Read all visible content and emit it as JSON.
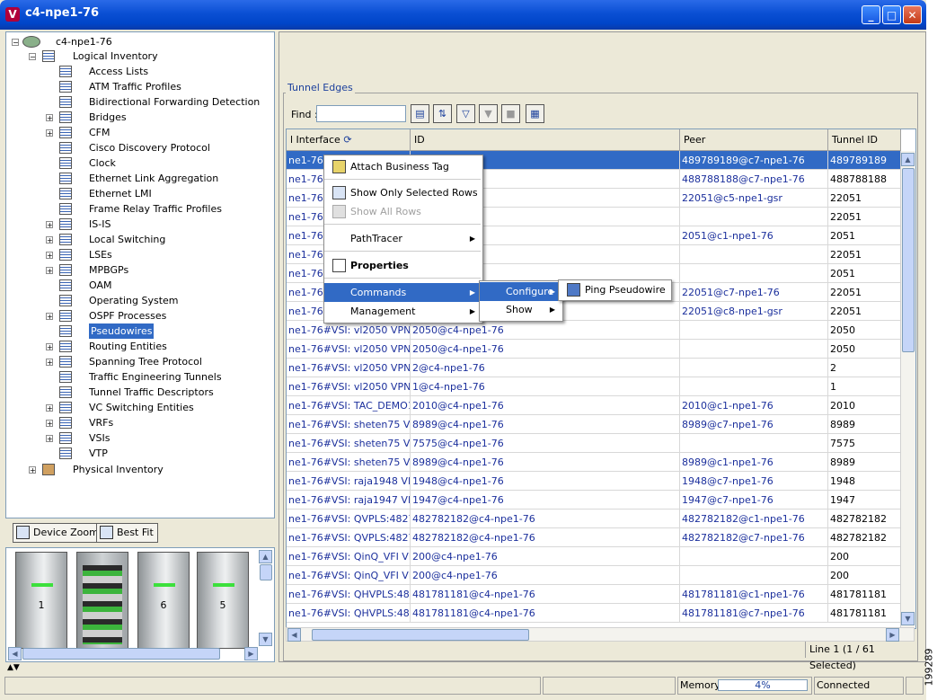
{
  "window": {
    "title": "c4-npe1-76",
    "app_icon": "V"
  },
  "tree": {
    "root": "c4-npe1-76",
    "logical": "Logical Inventory",
    "items": [
      {
        "label": "Access Lists",
        "exp": false
      },
      {
        "label": "ATM Traffic Profiles",
        "exp": false
      },
      {
        "label": "Bidirectional Forwarding Detection",
        "exp": false
      },
      {
        "label": "Bridges",
        "exp": true
      },
      {
        "label": "CFM",
        "exp": true
      },
      {
        "label": "Cisco Discovery Protocol",
        "exp": false
      },
      {
        "label": "Clock",
        "exp": false
      },
      {
        "label": "Ethernet Link Aggregation",
        "exp": false
      },
      {
        "label": "Ethernet LMI",
        "exp": false
      },
      {
        "label": "Frame Relay Traffic Profiles",
        "exp": false
      },
      {
        "label": "IS-IS",
        "exp": true
      },
      {
        "label": "Local Switching",
        "exp": true
      },
      {
        "label": "LSEs",
        "exp": true
      },
      {
        "label": "MPBGPs",
        "exp": true
      },
      {
        "label": "OAM",
        "exp": false
      },
      {
        "label": "Operating System",
        "exp": false
      },
      {
        "label": "OSPF Processes",
        "exp": true
      },
      {
        "label": "Pseudowires",
        "exp": false
      },
      {
        "label": "Routing Entities",
        "exp": true
      },
      {
        "label": "Spanning Tree Protocol",
        "exp": true
      },
      {
        "label": "Traffic Engineering Tunnels",
        "exp": false
      },
      {
        "label": "Tunnel Traffic Descriptors",
        "exp": false
      },
      {
        "label": "VC Switching Entities",
        "exp": true
      },
      {
        "label": "VRFs",
        "exp": true
      },
      {
        "label": "VSIs",
        "exp": true
      },
      {
        "label": "VTP",
        "exp": false
      }
    ],
    "selected": "Pseudowires",
    "physical": "Physical Inventory"
  },
  "zoom": {
    "device_zoom": "Device Zoom",
    "best_fit": "Best Fit"
  },
  "chassis": {
    "slots": [
      "1",
      "",
      "6",
      "5"
    ]
  },
  "tunnel": {
    "legend": "Tunnel Edges",
    "find_label": "Find :",
    "headers": [
      "l Interface",
      "ID",
      "Peer",
      "Tunnel ID"
    ],
    "rows": [
      [
        "ne1-76#V",
        "",
        "489789189@c7-npe1-76",
        "489789189"
      ],
      [
        "ne1-76#V",
        "",
        "488788188@c7-npe1-76",
        "488788188"
      ],
      [
        "ne1-76#V",
        "",
        "22051@c5-npe1-gsr",
        "22051"
      ],
      [
        "ne1-76#V",
        "",
        "",
        "22051"
      ],
      [
        "ne1-76#V",
        "",
        "2051@c1-npe1-76",
        "2051"
      ],
      [
        "ne1-76#V",
        "",
        "",
        "22051"
      ],
      [
        "ne1-76#V",
        "",
        "",
        "2051"
      ],
      [
        "ne1-76#V",
        "",
        "22051@c7-npe1-76",
        "22051"
      ],
      [
        "ne1-76#V",
        "",
        "22051@c8-npe1-gsr",
        "22051"
      ],
      [
        "ne1-76#VSI: vl2050 VPN I...",
        "2050@c4-npe1-76",
        "",
        "2050"
      ],
      [
        "ne1-76#VSI: vl2050 VPN I...",
        "2050@c4-npe1-76",
        "",
        "2050"
      ],
      [
        "ne1-76#VSI: vl2050 VPN I...",
        "2@c4-npe1-76",
        "",
        "2"
      ],
      [
        "ne1-76#VSI: vl2050 VPN I...",
        "1@c4-npe1-76",
        "",
        "1"
      ],
      [
        "ne1-76#VSI: TAC_DEMO1 ...",
        "2010@c4-npe1-76",
        "2010@c1-npe1-76",
        "2010"
      ],
      [
        "ne1-76#VSI: sheten75 VP...",
        "8989@c4-npe1-76",
        "8989@c7-npe1-76",
        "8989"
      ],
      [
        "ne1-76#VSI: sheten75 VP...",
        "7575@c4-npe1-76",
        "",
        "7575"
      ],
      [
        "ne1-76#VSI: sheten75 VP...",
        "8989@c4-npe1-76",
        "8989@c1-npe1-76",
        "8989"
      ],
      [
        "ne1-76#VSI: raja1948 VPN...",
        "1948@c4-npe1-76",
        "1948@c7-npe1-76",
        "1948"
      ],
      [
        "ne1-76#VSI: raja1947 VPN...",
        "1947@c4-npe1-76",
        "1947@c7-npe1-76",
        "1947"
      ],
      [
        "ne1-76#VSI: QVPLS:4827...",
        "482782182@c4-npe1-76",
        "482782182@c1-npe1-76",
        "482782182"
      ],
      [
        "ne1-76#VSI: QVPLS:4827...",
        "482782182@c4-npe1-76",
        "482782182@c7-npe1-76",
        "482782182"
      ],
      [
        "ne1-76#VSI: QinQ_VFI VP...",
        "200@c4-npe1-76",
        "",
        "200"
      ],
      [
        "ne1-76#VSI: QinQ_VFI VP...",
        "200@c4-npe1-76",
        "",
        "200"
      ],
      [
        "ne1-76#VSI: QHVPLS:481...",
        "481781181@c4-npe1-76",
        "481781181@c1-npe1-76",
        "481781181"
      ],
      [
        "ne1-76#VSI: QHVPLS:481...",
        "481781181@c4-npe1-76",
        "481781181@c7-npe1-76",
        "481781181"
      ]
    ],
    "status": "Line 1 (1 / 61 Selected)"
  },
  "context_menu": {
    "attach": "Attach Business Tag",
    "show_selected": "Show Only Selected Rows",
    "show_all": "Show All Rows",
    "pathtracer": "PathTracer",
    "properties": "Properties",
    "commands": "Commands",
    "management": "Management"
  },
  "submenu": {
    "configure": "Configure",
    "show": "Show"
  },
  "submenu2": {
    "ping": "Ping Pseudowire"
  },
  "statusbar": {
    "memory_label": "Memory:",
    "memory_value": "4%",
    "connection": "Connected"
  },
  "figure_id": "199289"
}
